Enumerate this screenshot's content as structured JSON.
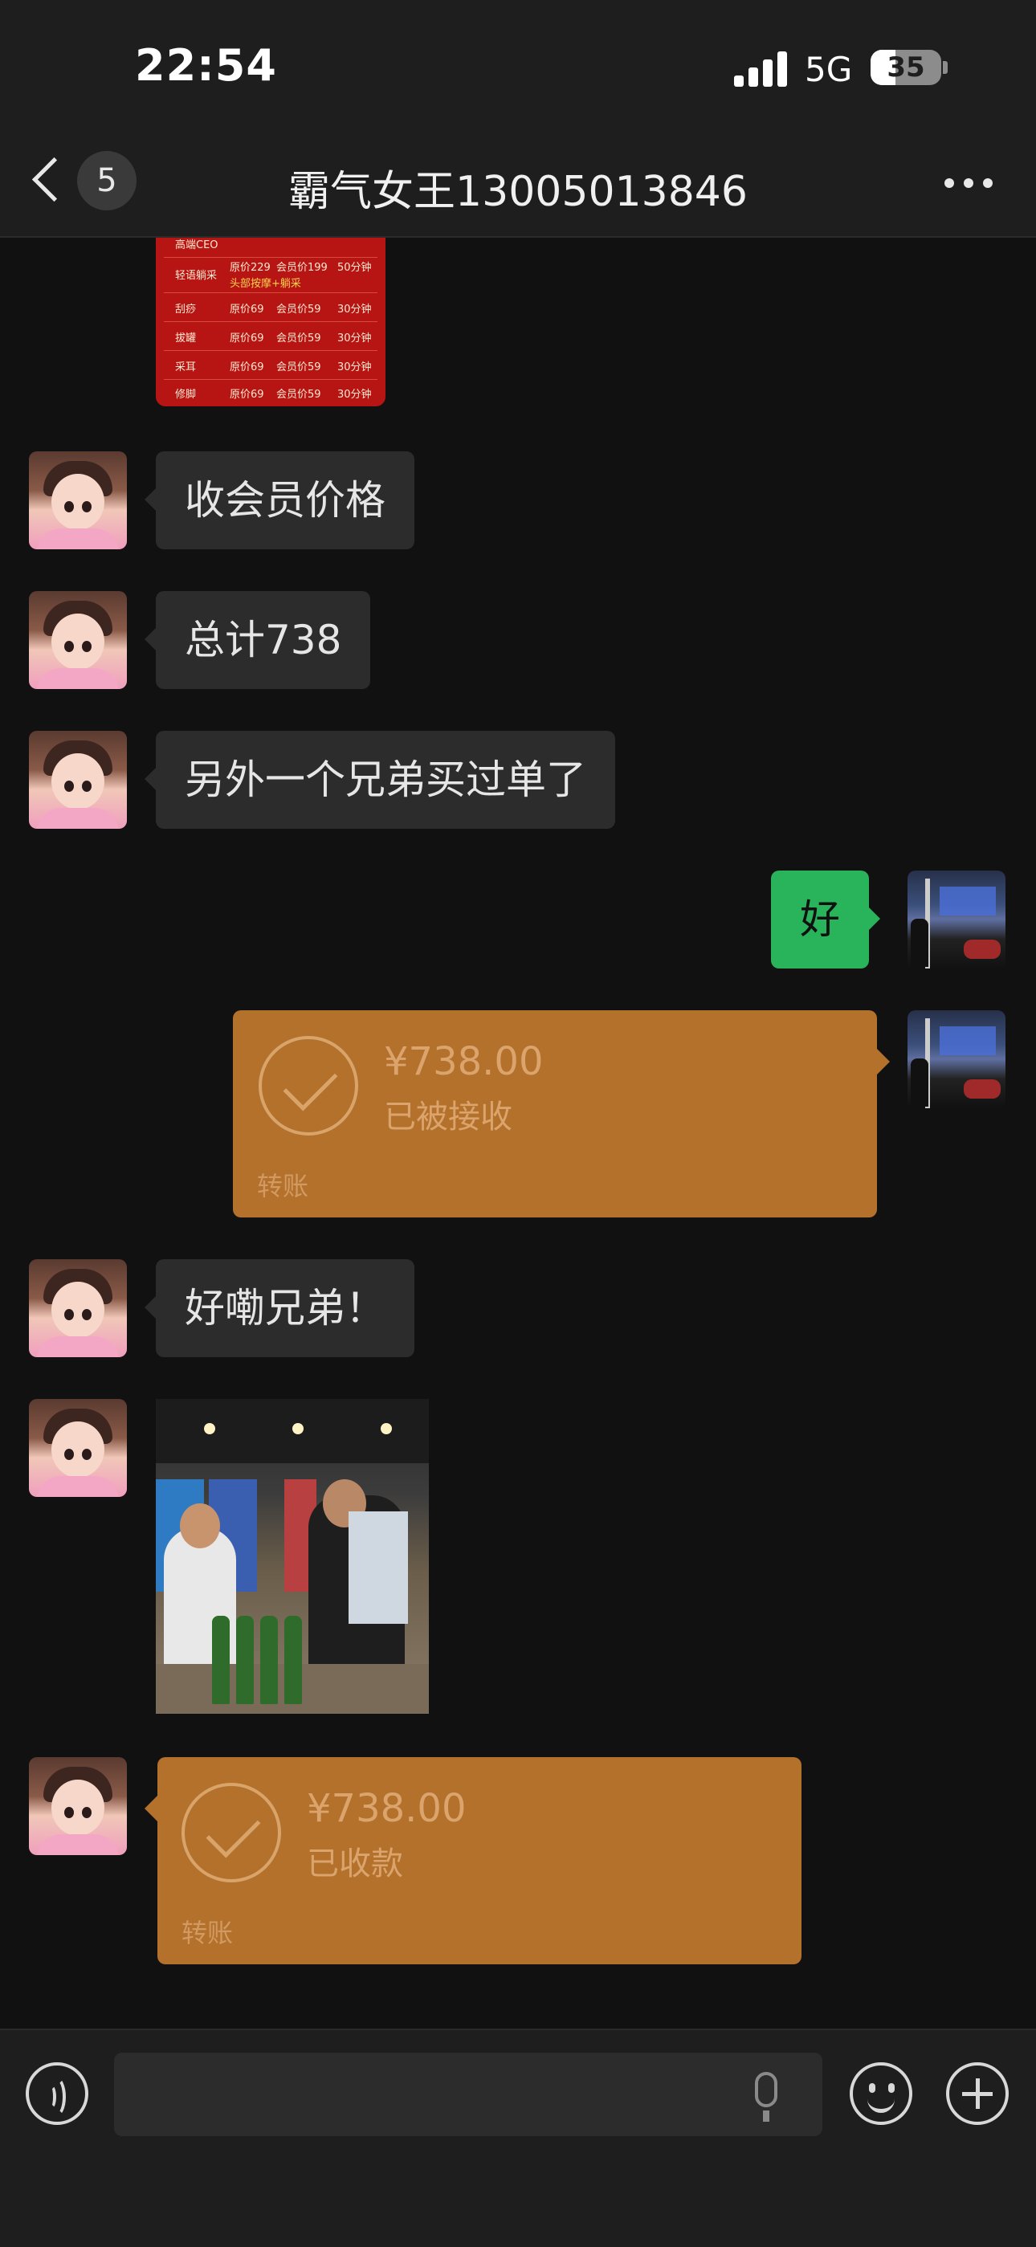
{
  "status_bar": {
    "time": "22:54",
    "network": "5G",
    "battery_level": "35",
    "battery_fraction": 0.35
  },
  "header": {
    "unread_count": "5",
    "title": "霸气女王13005013846"
  },
  "price_list": {
    "rows": [
      {
        "item": "高端CEO",
        "price": "",
        "member": "",
        "duration": ""
      },
      {
        "item": "轻语躺采",
        "price": "原价229",
        "member": "会员价199",
        "duration": "50分钟",
        "note": "头部按摩+躺采"
      },
      {
        "item": "刮痧",
        "price": "原价69",
        "member": "会员价59",
        "duration": "30分钟"
      },
      {
        "item": "拔罐",
        "price": "原价69",
        "member": "会员价59",
        "duration": "30分钟"
      },
      {
        "item": "采耳",
        "price": "原价69",
        "member": "会员价59",
        "duration": "30分钟"
      },
      {
        "item": "修脚",
        "price": "原价69",
        "member": "会员价59",
        "duration": "30分钟"
      }
    ]
  },
  "messages": {
    "m1": "收会员价格",
    "m2": "总计738",
    "m3": "另外一个兄弟买过单了",
    "m4": "好",
    "m5": "好嘞兄弟！"
  },
  "transfer_sent": {
    "amount": "¥738.00",
    "status": "已被接收",
    "label": "转账"
  },
  "transfer_received": {
    "amount": "¥738.00",
    "status": "已收款",
    "label": "转账"
  },
  "input": {
    "placeholder": ""
  },
  "icons": {
    "back": "chevron-left-icon",
    "more": "more-dots-icon",
    "voice": "voice-icon",
    "mic": "microphone-icon",
    "emoji": "emoji-icon",
    "plus": "plus-icon",
    "check": "check-circle-icon"
  },
  "colors": {
    "bg": "#111111",
    "bar": "#1e1e1e",
    "bubble_in": "#2c2c2c",
    "bubble_out": "#29b35a",
    "transfer": "#b3712c"
  }
}
